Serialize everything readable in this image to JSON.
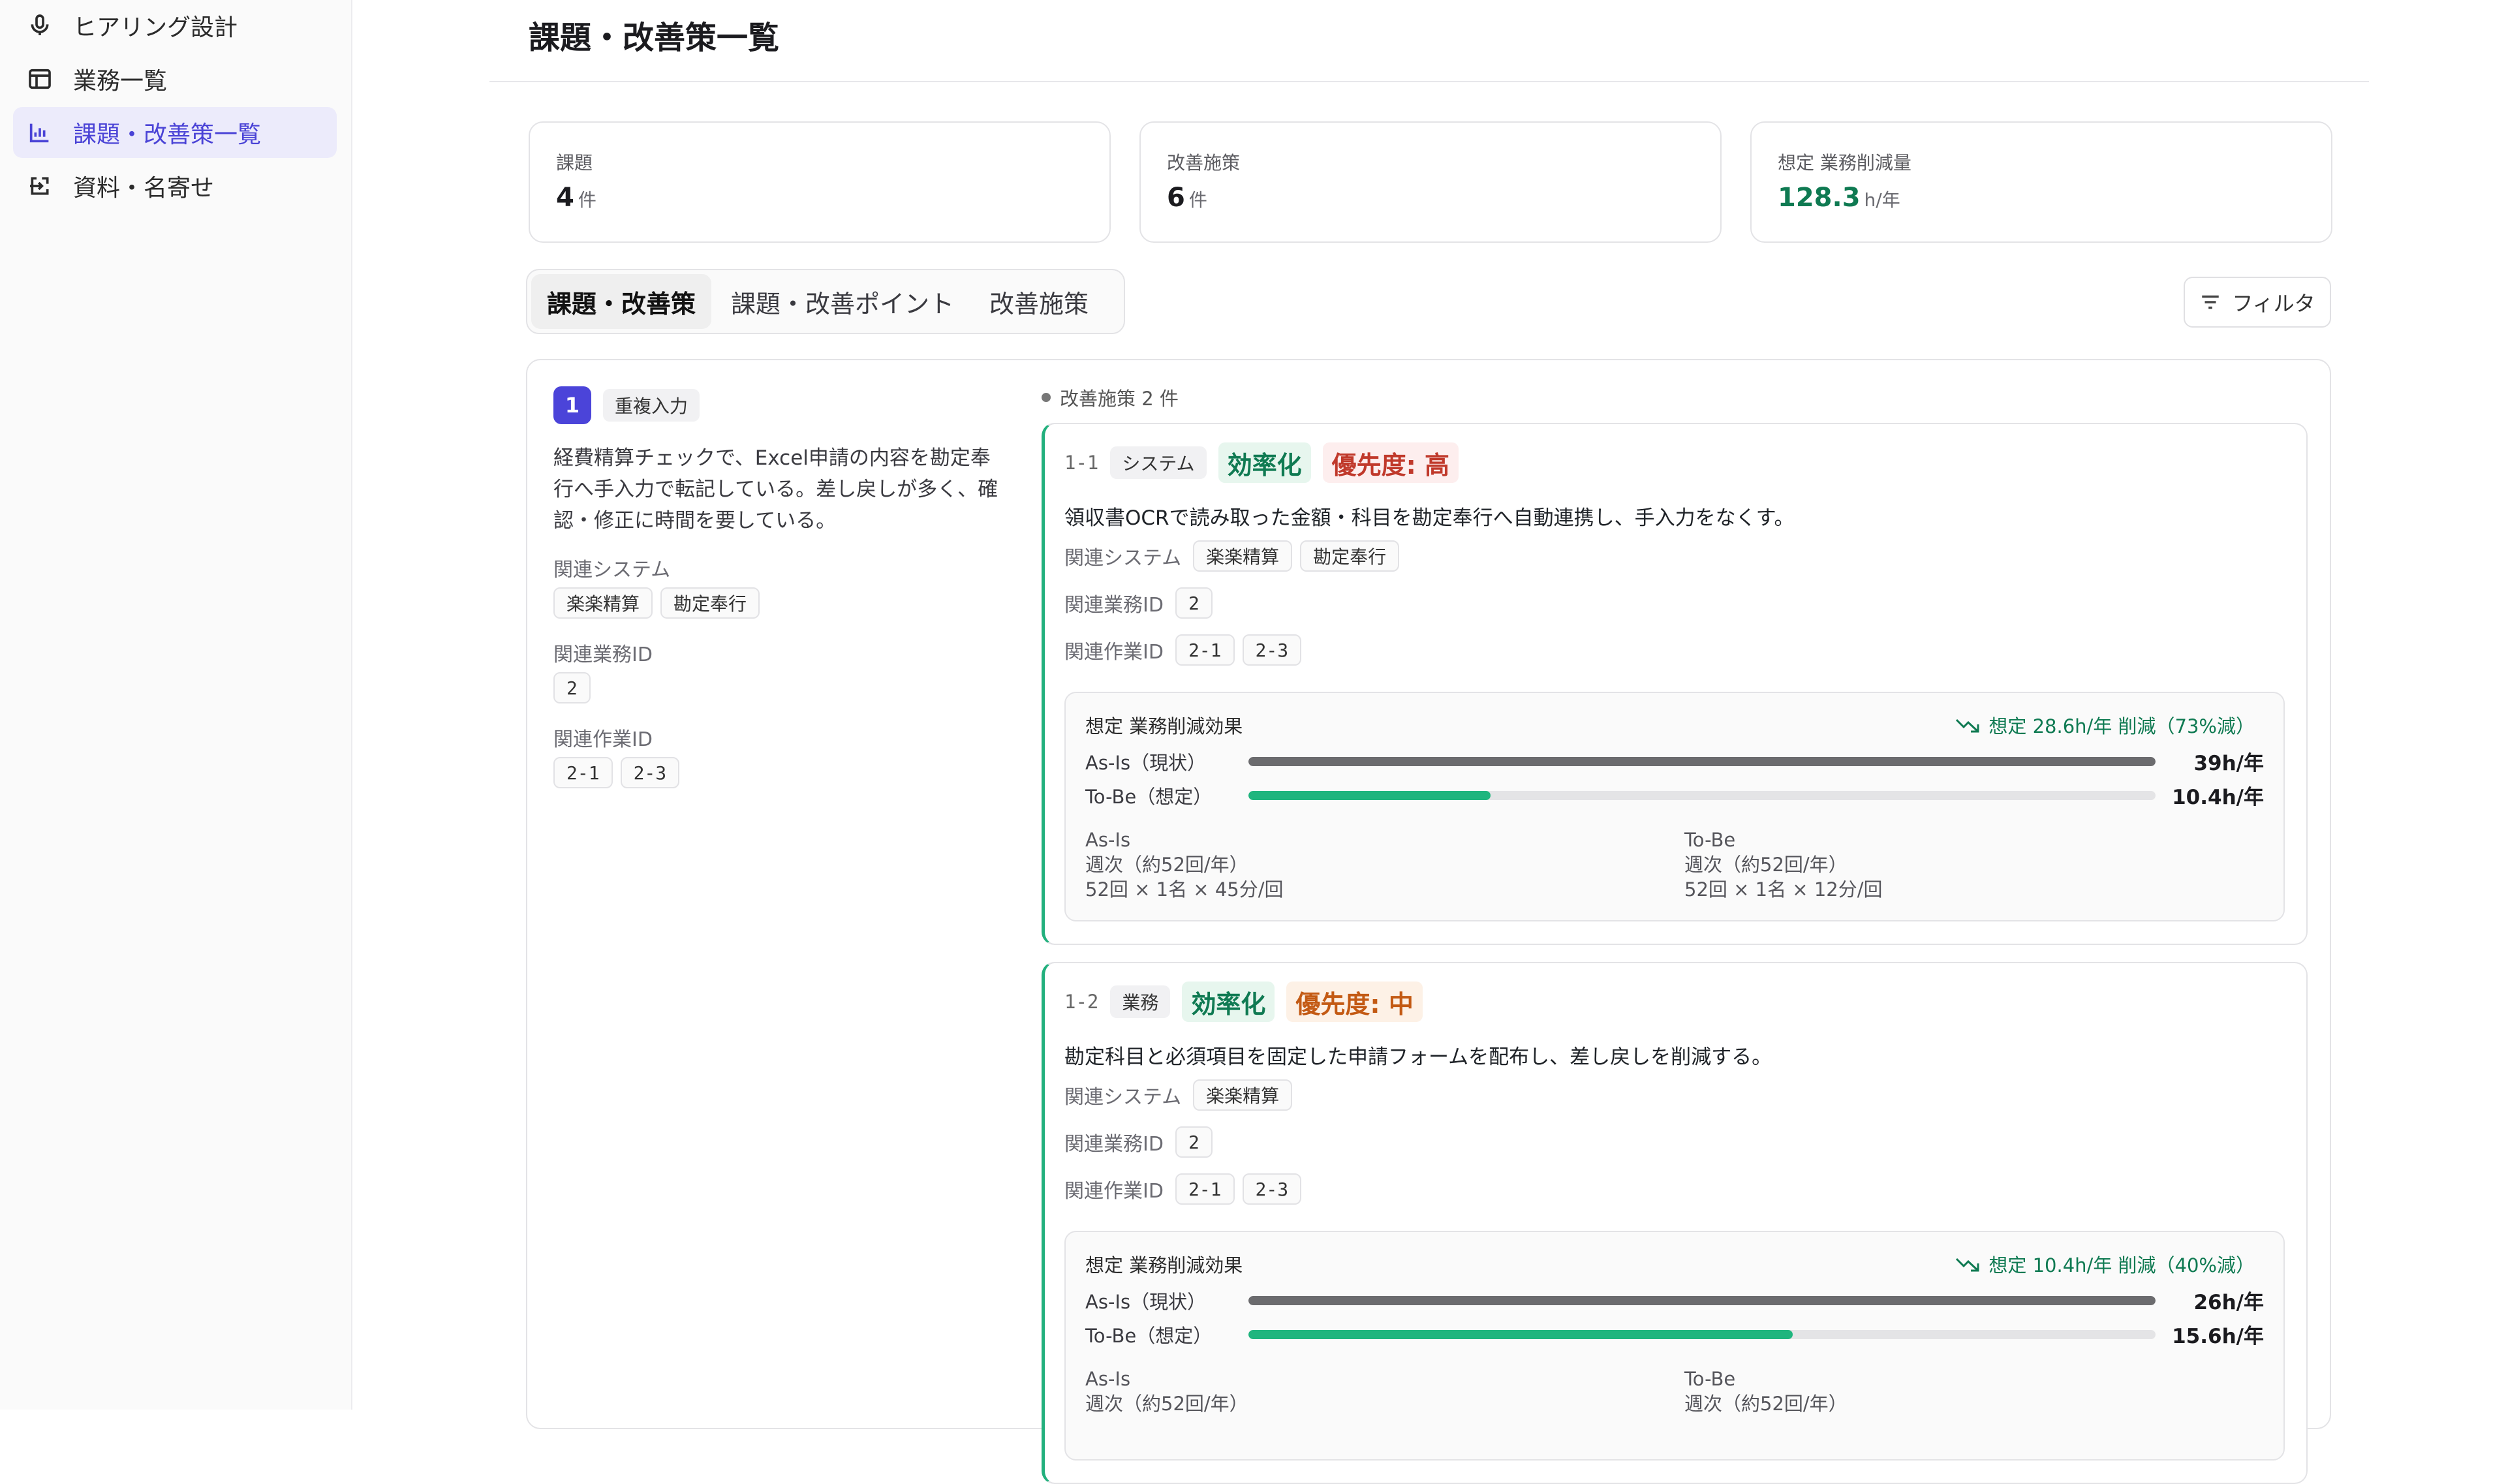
{
  "sidebar": {
    "items": [
      {
        "label": "ヒアリング設計",
        "icon": "mic-icon"
      },
      {
        "label": "業務一覧",
        "icon": "table-icon"
      },
      {
        "label": "課題・改善策一覧",
        "icon": "bar-chart-icon",
        "active": true
      },
      {
        "label": "資料・名寄せ",
        "icon": "import-icon"
      }
    ]
  },
  "header": {
    "title": "課題・改善策一覧"
  },
  "stats": [
    {
      "label": "課題",
      "value": "4",
      "unit": "件"
    },
    {
      "label": "改善施策",
      "value": "6",
      "unit": "件"
    },
    {
      "label": "想定 業務削減量",
      "value": "128.3",
      "unit": "h/年",
      "color": "#0f7a52"
    }
  ],
  "tabs": [
    "課題・改善策",
    "課題・改善ポイント",
    "改善施策"
  ],
  "filter_label": "フィルタ",
  "issue": {
    "number": "1",
    "tag": "重複入力",
    "description_lines": [
      "経費精算チェックで、Excel申請の内容を勘定奉",
      "行へ手入力で転記している。差し戻しが多く、確",
      "認・修正に時間を要している。"
    ],
    "systems_label": "関連システム",
    "systems": [
      "楽楽精算",
      "勘定奉行"
    ],
    "business_ids_label": "関連業務ID",
    "business_ids": [
      "2"
    ],
    "task_ids_label": "関連作業ID",
    "task_ids": [
      "2-1",
      "2-3"
    ],
    "measures_count": "改善施策 2 件"
  },
  "measures": [
    {
      "code": "1-1",
      "type": "システム",
      "category": "効率化",
      "priority": "優先度: 高",
      "description": "領収書OCRで読み取った金額・科目を勘定奉行へ自動連携し、手入力をなくす。",
      "systems_label": "関連システム",
      "systems": [
        "楽楽精算",
        "勘定奉行"
      ],
      "business_ids_label": "関連業務ID",
      "business_ids": [
        "2"
      ],
      "task_ids_label": "関連作業ID",
      "task_ids": [
        "2-1",
        "2-3"
      ],
      "effect": {
        "title": "想定 業務削減効果",
        "summary": "想定 28.6h/年 削減（73%減）",
        "asis_label": "As-Is（現状）",
        "asis_value": "39h/年",
        "asis_fraction": 1.0,
        "tobe_label": "To-Be（想定）",
        "tobe_value": "10.4h/年",
        "tobe_fraction": 0.267,
        "asis_title": "As-Is",
        "asis_freq": "週次（約52回/年）",
        "asis_calc": "52回 × 1名 × 45分/回",
        "tobe_title": "To-Be",
        "tobe_freq": "週次（約52回/年）",
        "tobe_calc": "52回 × 1名 × 12分/回"
      }
    },
    {
      "code": "1-2",
      "type": "業務",
      "category": "効率化",
      "priority": "優先度: 中",
      "description": "勘定科目と必須項目を固定した申請フォームを配布し、差し戻しを削減する。",
      "systems_label": "関連システム",
      "systems": [
        "楽楽精算"
      ],
      "business_ids_label": "関連業務ID",
      "business_ids": [
        "2"
      ],
      "task_ids_label": "関連作業ID",
      "task_ids": [
        "2-1",
        "2-3"
      ],
      "effect": {
        "title": "想定 業務削減効果",
        "summary": "想定 10.4h/年 削減（40%減）",
        "asis_label": "As-Is（現状）",
        "asis_value": "26h/年",
        "asis_fraction": 1.0,
        "tobe_label": "To-Be（想定）",
        "tobe_value": "15.6h/年",
        "tobe_fraction": 0.6,
        "asis_title": "As-Is",
        "asis_freq": "週次（約52回/年）",
        "tobe_title": "To-Be",
        "tobe_freq": "週次（約52回/年）"
      }
    }
  ],
  "colors": {
    "accent": "#4b44d9",
    "green": "#0f7a52",
    "bar_green": "#1fb57e",
    "bar_gray": "#6b6b6e"
  }
}
